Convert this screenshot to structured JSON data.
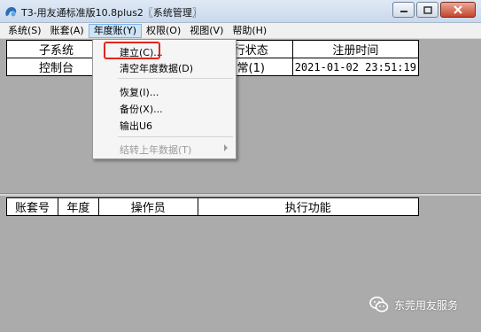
{
  "window": {
    "title": "T3-用友通标准版10.8plus2〖系统管理〗"
  },
  "menubar": {
    "items": [
      "系统(S)",
      "账套(A)",
      "年度账(Y)",
      "权限(O)",
      "视图(V)",
      "帮助(H)"
    ]
  },
  "dropdown": {
    "items": [
      {
        "label": "建立(C)...",
        "enabled": true
      },
      {
        "label": "清空年度数据(D)",
        "enabled": true
      },
      {
        "label": "恢复(I)...",
        "enabled": true
      },
      {
        "label": "备份(X)...",
        "enabled": true
      },
      {
        "label": "输出U6",
        "enabled": true
      },
      {
        "label": "结转上年数据(T)",
        "enabled": false
      }
    ]
  },
  "subsystem_table": {
    "headers": [
      "子系统",
      "",
      "运行状态",
      "注册时间"
    ],
    "rows": [
      [
        "控制台",
        "",
        "正常(1)",
        "2021-01-02 23:51:19"
      ]
    ]
  },
  "task_table": {
    "headers": [
      "账套号",
      "年度",
      "操作员",
      "执行功能"
    ]
  },
  "watermark": {
    "text": "东莞用友服务"
  }
}
